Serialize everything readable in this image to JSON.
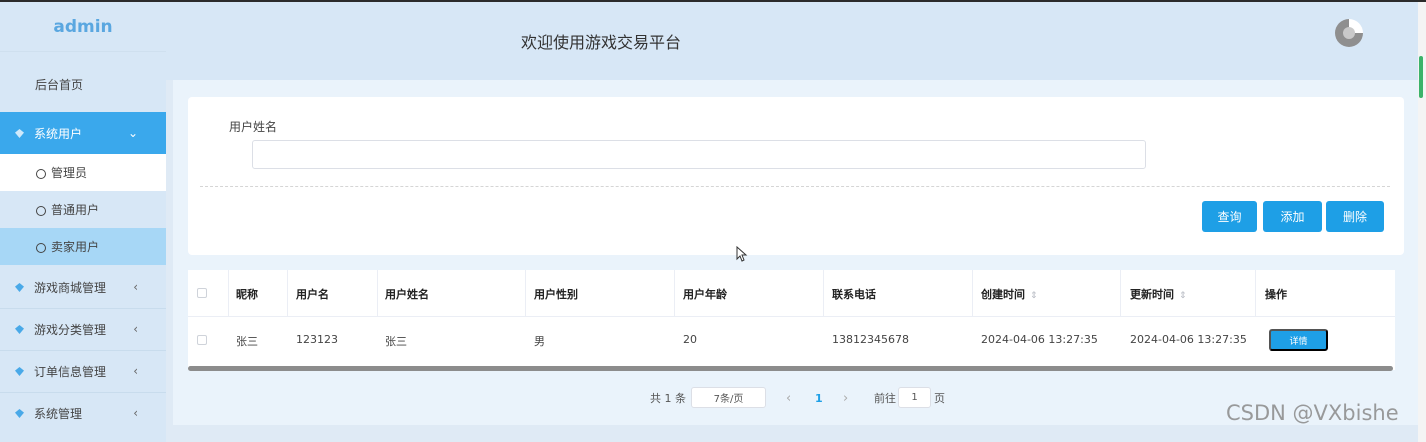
{
  "sidebar": {
    "logo": "admin",
    "home": "后台首页",
    "system_users": "系统用户",
    "sub_items": [
      "管理员",
      "普通用户",
      "卖家用户"
    ],
    "groups": [
      "游戏商城管理",
      "游戏分类管理",
      "订单信息管理",
      "系统管理"
    ]
  },
  "header": {
    "title": "欢迎使用游戏交易平台"
  },
  "search": {
    "label": "用户姓名",
    "value": "",
    "buttons": {
      "query": "查询",
      "add": "添加",
      "delete": "删除"
    }
  },
  "table": {
    "columns": [
      "昵称",
      "用户名",
      "用户姓名",
      "用户性别",
      "用户年龄",
      "联系电话",
      "创建时间",
      "更新时间",
      "操作"
    ],
    "sort_icon": "⇕",
    "rows": [
      {
        "nickname": "张三",
        "username": "123123",
        "name": "张三",
        "gender": "男",
        "age": "20",
        "phone": "13812345678",
        "created": "2024-04-06 13:27:35",
        "updated": "2024-04-06 13:27:35",
        "action": "详情"
      }
    ]
  },
  "pagination": {
    "total": "共 1 条",
    "page_size": "7条/页",
    "prev": "‹",
    "current": "1",
    "next": "›",
    "goto_label": "前往",
    "goto_value": "1",
    "page_suffix": "页"
  },
  "watermark": "CSDN @VXbishe",
  "colors": {
    "accent": "#1e9fe6",
    "sidebar_active": "#3aa8ec",
    "sidebar_bg": "#d7e7f6"
  }
}
